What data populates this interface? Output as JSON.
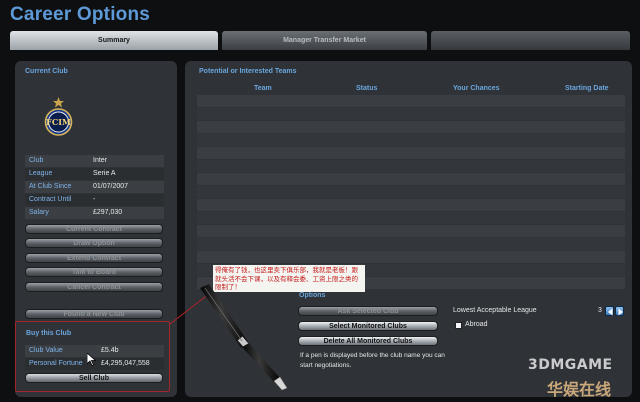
{
  "page": {
    "title": "Career Options"
  },
  "tabs": [
    {
      "label": "Summary",
      "active": true
    },
    {
      "label": "Manager Transfer Market",
      "active": false
    },
    {
      "label": "",
      "active": false
    }
  ],
  "current_club": {
    "section_title": "Current Club",
    "crest_icon": "inter-milan-crest",
    "rows": [
      {
        "label": "Club",
        "value": "Inter"
      },
      {
        "label": "League",
        "value": "Serie A"
      },
      {
        "label": "At Club Since",
        "value": "01/07/2007"
      },
      {
        "label": "Contract Until",
        "value": "-"
      },
      {
        "label": "Salary",
        "value": "£297,030"
      }
    ],
    "buttons": [
      {
        "label": "Current Contract",
        "enabled": false
      },
      {
        "label": "Draw Option",
        "enabled": false
      },
      {
        "label": "Extend Contract",
        "enabled": false
      },
      {
        "label": "Talk to Board",
        "enabled": false
      },
      {
        "label": "Cancel Contract",
        "enabled": false
      },
      {
        "label": "Found a New Club",
        "enabled": false
      }
    ]
  },
  "buy_club": {
    "section_title": "Buy this Club",
    "rows": [
      {
        "label": "Club Value",
        "value": "£5.4b"
      },
      {
        "label": "Personal Fortune",
        "value": "£4,295,047,558"
      }
    ],
    "sell_button": "Sell Club"
  },
  "teams": {
    "section_title": "Potential or Interested Teams",
    "columns": [
      "Team",
      "Status",
      "Your Chances",
      "Starting Date"
    ],
    "rows": []
  },
  "annotation": {
    "text": "得俺有了钱，也这里卖下俱乐部，我就是老板！跟就头活不会下课，以及有释会委、工资上限之类的限制了！",
    "color": "#c41b1b"
  },
  "options": {
    "section_title": "Options",
    "buttons": [
      {
        "label": "Ask Selected Club",
        "enabled": false
      },
      {
        "label": "Select Monitored Clubs",
        "enabled": true
      },
      {
        "label": "Delete All Monitored Clubs",
        "enabled": true
      }
    ],
    "note": "If a pen is displayed before the club name you can start negotiations.",
    "lowest_league_label": "Lowest Acceptable League",
    "lowest_league_value": "3",
    "abroad_label": "Abroad",
    "abroad_checked": false
  },
  "watermark": {
    "line1": "3DMGAME",
    "line2": "华娱在线"
  },
  "colors": {
    "accent": "#5d9ad7",
    "label": "#7fb4ea",
    "highlight_border": "#a3242a"
  }
}
